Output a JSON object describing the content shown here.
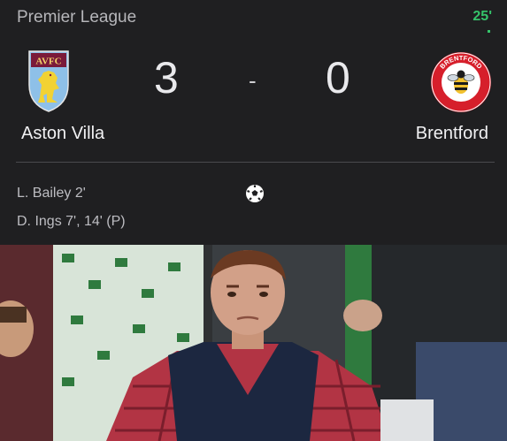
{
  "header": {
    "league": "Premier League",
    "minute": "25'"
  },
  "home": {
    "name": "Aston Villa",
    "score": "3",
    "crest_text": "AVFC",
    "crest_icon": "aston-villa-crest-icon"
  },
  "away": {
    "name": "Brentford",
    "score": "0",
    "crest_text": "BRENTFORD FOOTBALL CLUB",
    "crest_icon": "brentford-crest-icon"
  },
  "separator": "-",
  "scorers": [
    "L. Bailey 2'",
    "D. Ings 7', 14' (P)"
  ],
  "colors": {
    "accent_live": "#35c36a",
    "villa_claret": "#7a1a3a",
    "villa_blue": "#8ec0e8",
    "brentford_red": "#d61f2b"
  }
}
